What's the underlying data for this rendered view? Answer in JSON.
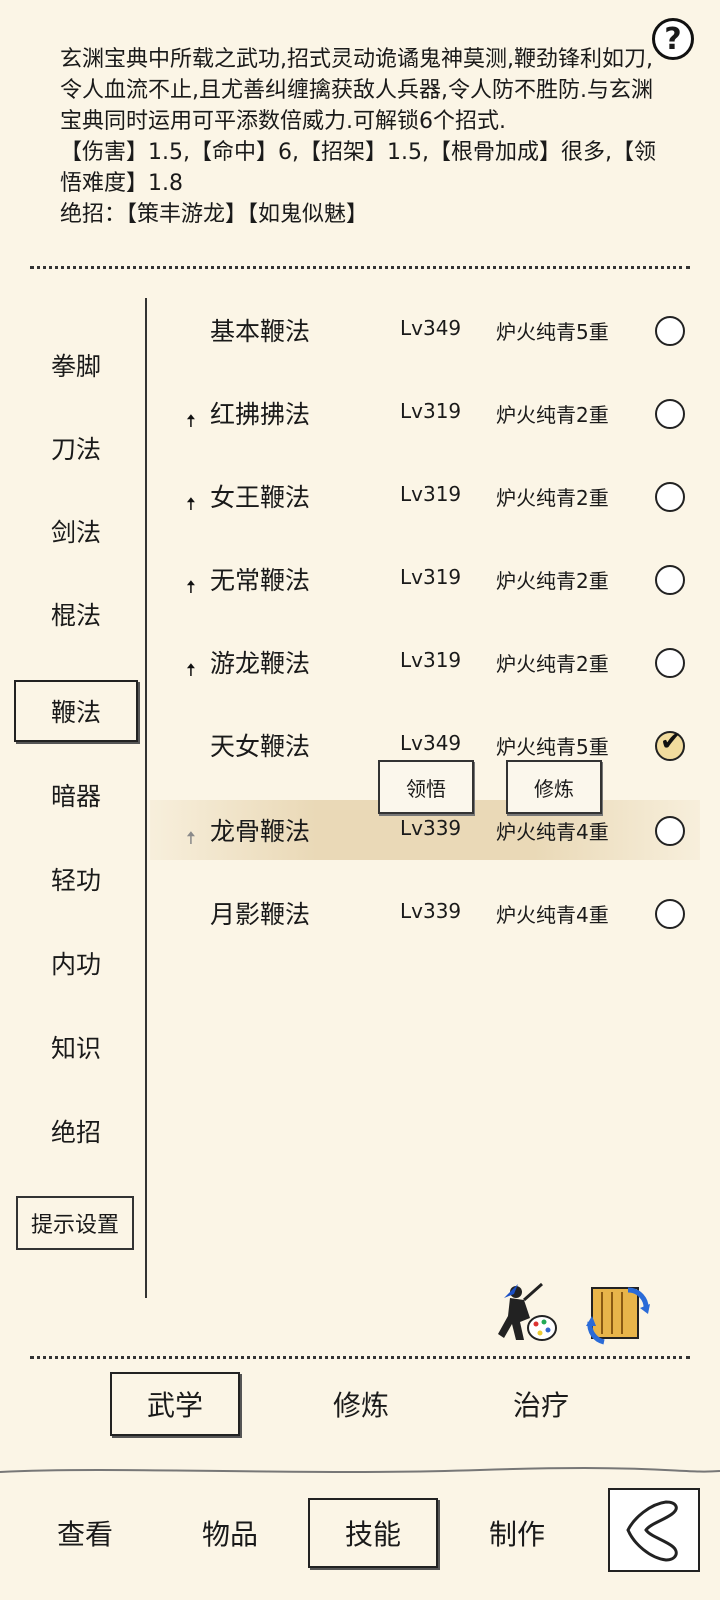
{
  "description": {
    "text": "玄渊宝典中所载之武功,招式灵动诡谲鬼神莫测,鞭劲锋利如刀,令人血流不止,且尤善纠缠擒获敌人兵器,令人防不胜防.与玄渊宝典同时运用可平添数倍威力.可解锁6个招式.",
    "stats": "【伤害】1.5,【命中】6,【招架】1.5,【根骨加成】很多,【领悟难度】1.8",
    "ultimates": "绝招：【策丰游龙】【如鬼似魅】"
  },
  "help_label": "?",
  "categories": [
    {
      "label": "拳脚"
    },
    {
      "label": "刀法"
    },
    {
      "label": "剑法"
    },
    {
      "label": "棍法"
    },
    {
      "label": "鞭法",
      "active": true
    },
    {
      "label": "暗器"
    },
    {
      "label": "轻功"
    },
    {
      "label": "内功"
    },
    {
      "label": "知识"
    },
    {
      "label": "绝招"
    }
  ],
  "hint_settings_label": "提示设置",
  "skills": [
    {
      "name": "基本鞭法",
      "level": "Lv349",
      "realm": "炉火纯青5重",
      "upgradable": false,
      "selected": false
    },
    {
      "name": "红拂拂法",
      "level": "Lv319",
      "realm": "炉火纯青2重",
      "upgradable": true,
      "selected": false
    },
    {
      "name": "女王鞭法",
      "level": "Lv319",
      "realm": "炉火纯青2重",
      "upgradable": true,
      "selected": false
    },
    {
      "name": "无常鞭法",
      "level": "Lv319",
      "realm": "炉火纯青2重",
      "upgradable": true,
      "selected": false
    },
    {
      "name": "游龙鞭法",
      "level": "Lv319",
      "realm": "炉火纯青2重",
      "upgradable": true,
      "selected": false
    },
    {
      "name": "天女鞭法",
      "level": "Lv349",
      "realm": "炉火纯青5重",
      "upgradable": false,
      "selected": true
    },
    {
      "name": "龙骨鞭法",
      "level": "Lv339",
      "realm": "炉火纯青4重",
      "upgradable": true,
      "selected": false
    },
    {
      "name": "月影鞭法",
      "level": "Lv339",
      "realm": "炉火纯青4重",
      "upgradable": false,
      "selected": false
    }
  ],
  "popup": {
    "comprehend_label": "领悟",
    "train_label": "修炼"
  },
  "tabs": [
    {
      "label": "武学",
      "active": true
    },
    {
      "label": "修炼"
    },
    {
      "label": "治疗"
    }
  ],
  "nav": [
    {
      "label": "查看"
    },
    {
      "label": "物品"
    },
    {
      "label": "技能",
      "active": true
    },
    {
      "label": "制作"
    }
  ],
  "icons": {
    "upgrade": "upgrade-arrow-icon",
    "painter": "painter-palette-icon",
    "swap": "swap-scroll-icon",
    "back": "back-icon"
  }
}
